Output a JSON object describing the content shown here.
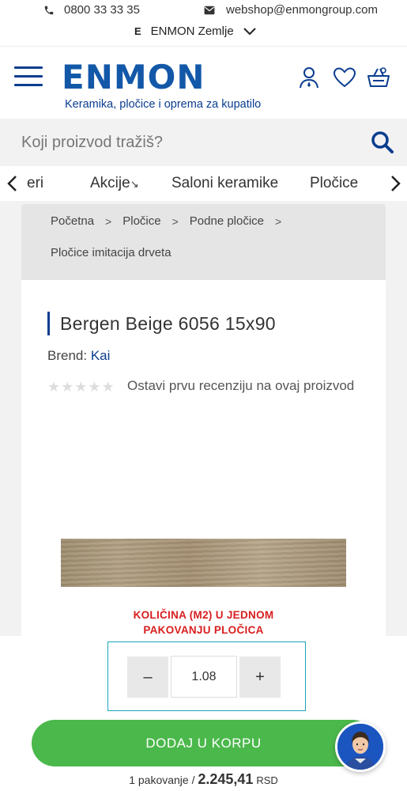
{
  "topbar": {
    "phone": "0800 33 33 35",
    "email": "webshop@enmongroup.com",
    "country_code": "E",
    "country": "ENMON Zemlje"
  },
  "header": {
    "logo": "ENMON",
    "tagline": "Keramika, pločice i oprema za kupatilo"
  },
  "search": {
    "placeholder": "Koji proizvod tražiš?"
  },
  "categories": [
    "eri",
    "Akcije",
    "Saloni keramike",
    "Pločice"
  ],
  "breadcrumb": [
    "Početna",
    "Pločice",
    "Podne pločice",
    "Pločice imitacija drveta"
  ],
  "product": {
    "title": "Bergen Beige 6056 15x90",
    "brand_label": "Brend:",
    "brand": "Kai",
    "rating": 0,
    "rating_max": 5,
    "review_cta": "Ostavi prvu recenziju na ovaj proizvod",
    "pack_line1": "KOLIČINA (M2) U JEDNOM",
    "pack_line2": "PAKOVANJU PLOČICA"
  },
  "cart": {
    "minus": "–",
    "quantity": "1.08",
    "plus": "+",
    "add_label": "DODAJ U KORPU",
    "price_prefix": "1 pakovanje / ",
    "price": "2.245,41",
    "currency": "RSD"
  },
  "colors": {
    "brand_blue": "#1358a8",
    "accent_red": "#d81e1e",
    "add_green": "#4bb84b",
    "qty_border": "#1aa5b8"
  }
}
